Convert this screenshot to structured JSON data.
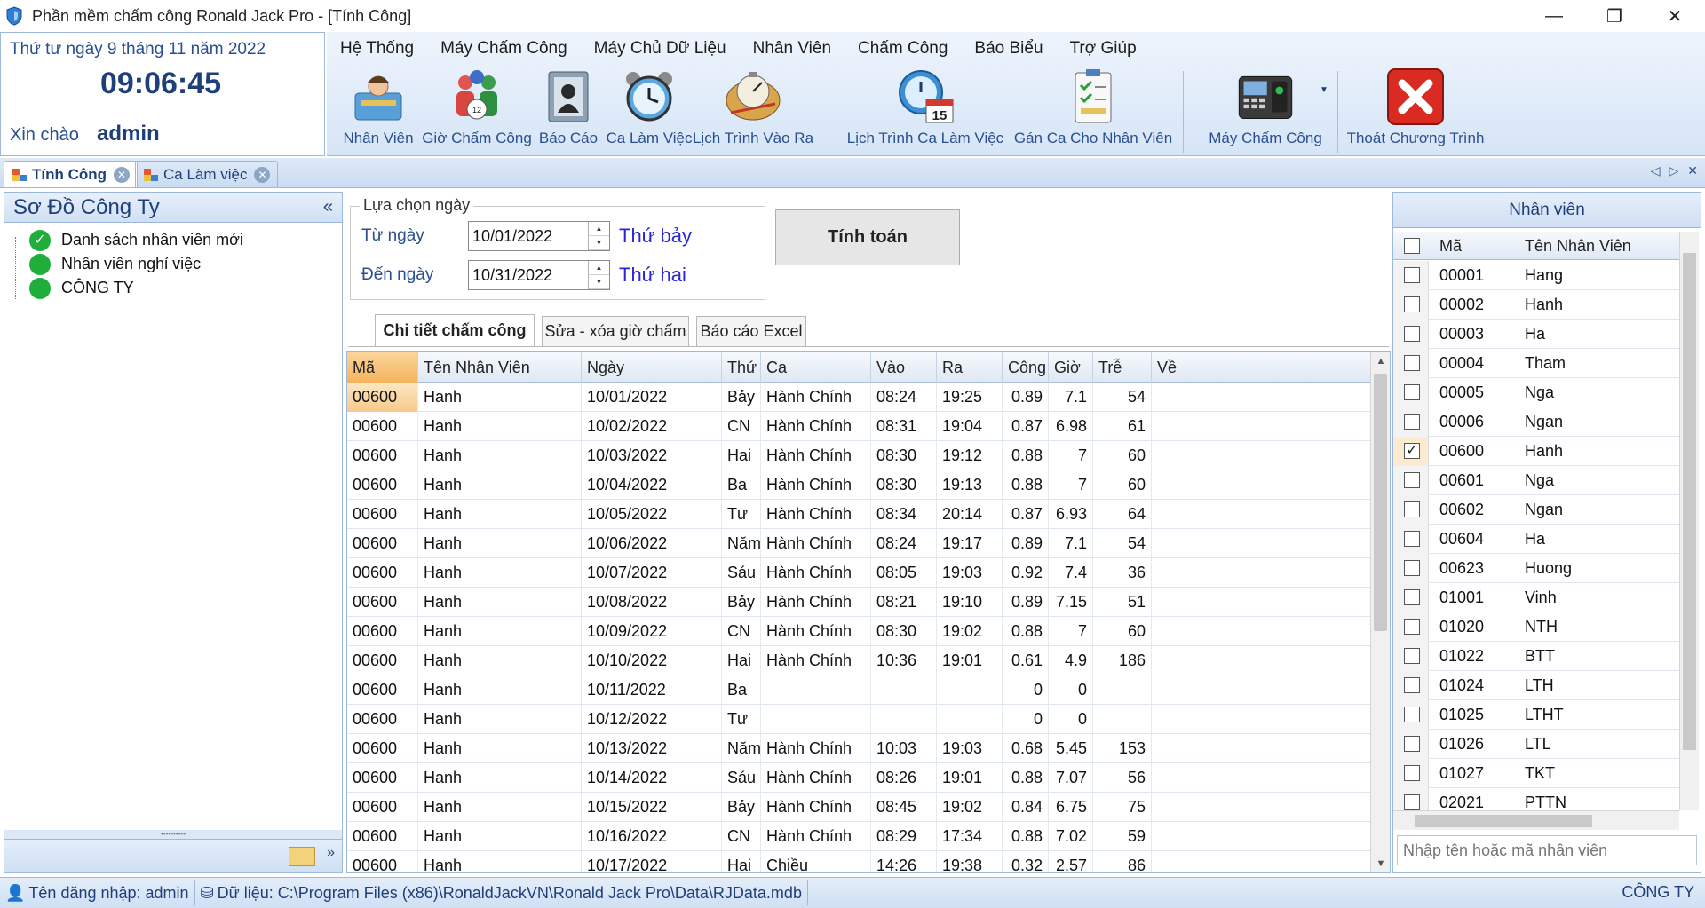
{
  "window": {
    "title": "Phần mềm chấm công Ronald Jack Pro - [Tính Công]",
    "minimize": "—",
    "restore": "❐",
    "close": "✕"
  },
  "clock": {
    "date": "Thứ tư ngày 9 tháng 11 năm 2022",
    "time": "09:06:45",
    "greeting": "Xin chào",
    "user": "admin"
  },
  "menu": [
    "Hệ Thống",
    "Máy Chấm Công",
    "Máy Chủ Dữ Liệu",
    "Nhân Viên",
    "Chấm Công",
    "Báo Biểu",
    "Trợ Giúp"
  ],
  "toolbar": [
    {
      "label": "Nhân Viên",
      "icon": "employee-icon"
    },
    {
      "label": "Giờ Chấm Công",
      "icon": "group-clock-icon"
    },
    {
      "label": "Báo Cáo",
      "icon": "report-icon"
    },
    {
      "label": "Ca Làm Việc",
      "icon": "alarm-clock-icon"
    },
    {
      "label": "Lịch Trình Vào Ra",
      "icon": "stopwatch-icon"
    },
    {
      "label": "Lịch Trình Ca Làm Việc",
      "icon": "calendar-clock-icon"
    },
    {
      "label": "Gán Ca Cho Nhân Viên",
      "icon": "clipboard-icon"
    },
    {
      "label": "Máy Chấm Công",
      "icon": "attendance-device-icon"
    },
    {
      "label": "Thoát Chương Trình",
      "icon": "exit-icon"
    }
  ],
  "doc_tabs": [
    {
      "label": "Tính Công",
      "active": true
    },
    {
      "label": "Ca Làm việc",
      "active": false
    }
  ],
  "tree": {
    "title": "Sơ Đồ Công Ty",
    "collapse": "«",
    "items": [
      "Danh sách nhân viên mới",
      "Nhân viên nghỉ việc",
      "CÔNG TY"
    ]
  },
  "date_select": {
    "legend": "Lựa chọn ngày",
    "from_label": "Từ ngày",
    "from_value": "10/01/2022",
    "from_dow": "Thứ bảy",
    "to_label": "Đến ngày",
    "to_value": "10/31/2022",
    "to_dow": "Thứ hai"
  },
  "calc_button": "Tính toán",
  "sub_tabs": [
    "Chi tiết chấm công",
    "Sửa - xóa giờ chấm",
    "Báo cáo Excel"
  ],
  "grid": {
    "columns": [
      "Mã",
      "Tên Nhân Viên",
      "Ngày",
      "Thứ",
      "Ca",
      "Vào",
      "Ra",
      "Công",
      "Giờ",
      "Trễ",
      "Về"
    ],
    "rows": [
      [
        "00600",
        "Hanh",
        "10/01/2022",
        "Bảy",
        "Hành Chính",
        "08:24",
        "19:25",
        "0.89",
        "7.1",
        "54",
        ""
      ],
      [
        "00600",
        "Hanh",
        "10/02/2022",
        "CN",
        "Hành Chính",
        "08:31",
        "19:04",
        "0.87",
        "6.98",
        "61",
        ""
      ],
      [
        "00600",
        "Hanh",
        "10/03/2022",
        "Hai",
        "Hành Chính",
        "08:30",
        "19:12",
        "0.88",
        "7",
        "60",
        ""
      ],
      [
        "00600",
        "Hanh",
        "10/04/2022",
        "Ba",
        "Hành Chính",
        "08:30",
        "19:13",
        "0.88",
        "7",
        "60",
        ""
      ],
      [
        "00600",
        "Hanh",
        "10/05/2022",
        "Tư",
        "Hành Chính",
        "08:34",
        "20:14",
        "0.87",
        "6.93",
        "64",
        ""
      ],
      [
        "00600",
        "Hanh",
        "10/06/2022",
        "Năm",
        "Hành Chính",
        "08:24",
        "19:17",
        "0.89",
        "7.1",
        "54",
        ""
      ],
      [
        "00600",
        "Hanh",
        "10/07/2022",
        "Sáu",
        "Hành Chính",
        "08:05",
        "19:03",
        "0.92",
        "7.4",
        "36",
        ""
      ],
      [
        "00600",
        "Hanh",
        "10/08/2022",
        "Bảy",
        "Hành Chính",
        "08:21",
        "19:10",
        "0.89",
        "7.15",
        "51",
        ""
      ],
      [
        "00600",
        "Hanh",
        "10/09/2022",
        "CN",
        "Hành Chính",
        "08:30",
        "19:02",
        "0.88",
        "7",
        "60",
        ""
      ],
      [
        "00600",
        "Hanh",
        "10/10/2022",
        "Hai",
        "Hành Chính",
        "10:36",
        "19:01",
        "0.61",
        "4.9",
        "186",
        ""
      ],
      [
        "00600",
        "Hanh",
        "10/11/2022",
        "Ba",
        "",
        "",
        "",
        "0",
        "0",
        "",
        ""
      ],
      [
        "00600",
        "Hanh",
        "10/12/2022",
        "Tư",
        "",
        "",
        "",
        "0",
        "0",
        "",
        ""
      ],
      [
        "00600",
        "Hanh",
        "10/13/2022",
        "Năm",
        "Hành Chính",
        "10:03",
        "19:03",
        "0.68",
        "5.45",
        "153",
        ""
      ],
      [
        "00600",
        "Hanh",
        "10/14/2022",
        "Sáu",
        "Hành Chính",
        "08:26",
        "19:01",
        "0.88",
        "7.07",
        "56",
        ""
      ],
      [
        "00600",
        "Hanh",
        "10/15/2022",
        "Bảy",
        "Hành Chính",
        "08:45",
        "19:02",
        "0.84",
        "6.75",
        "75",
        ""
      ],
      [
        "00600",
        "Hanh",
        "10/16/2022",
        "CN",
        "Hành Chính",
        "08:29",
        "17:34",
        "0.88",
        "7.02",
        "59",
        ""
      ],
      [
        "00600",
        "Hanh",
        "10/17/2022",
        "Hai",
        "Chiều",
        "14:26",
        "19:38",
        "0.32",
        "2.57",
        "86",
        ""
      ]
    ]
  },
  "employees": {
    "title": "Nhân viên",
    "col_code": "Mã",
    "col_name": "Tên Nhân Viên",
    "rows": [
      {
        "code": "00001",
        "name": "Hang",
        "checked": false
      },
      {
        "code": "00002",
        "name": "Hanh",
        "checked": false
      },
      {
        "code": "00003",
        "name": "Ha",
        "checked": false
      },
      {
        "code": "00004",
        "name": "Tham",
        "checked": false
      },
      {
        "code": "00005",
        "name": "Nga",
        "checked": false
      },
      {
        "code": "00006",
        "name": "Ngan",
        "checked": false
      },
      {
        "code": "00600",
        "name": "Hanh",
        "checked": true
      },
      {
        "code": "00601",
        "name": "Nga",
        "checked": false
      },
      {
        "code": "00602",
        "name": "Ngan",
        "checked": false
      },
      {
        "code": "00604",
        "name": "Ha",
        "checked": false
      },
      {
        "code": "00623",
        "name": "Huong",
        "checked": false
      },
      {
        "code": "01001",
        "name": "Vinh",
        "checked": false
      },
      {
        "code": "01020",
        "name": "NTH",
        "checked": false
      },
      {
        "code": "01022",
        "name": "BTT",
        "checked": false
      },
      {
        "code": "01024",
        "name": "LTH",
        "checked": false
      },
      {
        "code": "01025",
        "name": "LTHT",
        "checked": false
      },
      {
        "code": "01026",
        "name": "LTL",
        "checked": false
      },
      {
        "code": "01027",
        "name": "TKT",
        "checked": false
      },
      {
        "code": "02021",
        "name": "PTTN",
        "checked": false
      }
    ],
    "search_placeholder": "Nhập tên hoặc mã nhân viên"
  },
  "status": {
    "login": "Tên đăng nhập: admin",
    "data": "Dữ liệu: C:\\Program Files (x86)\\RonaldJackVN\\Ronald Jack Pro\\Data\\RJData.mdb",
    "company": "CÔNG TY"
  }
}
